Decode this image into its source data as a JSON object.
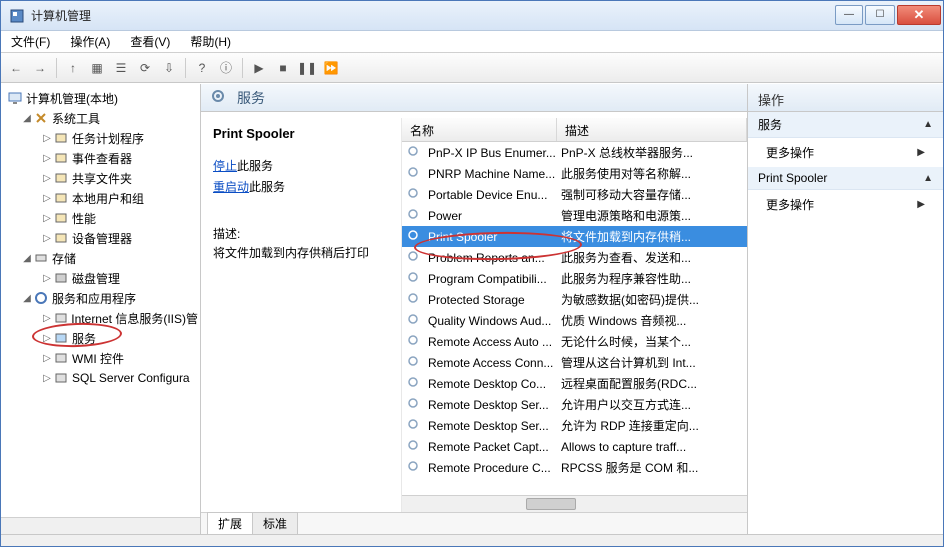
{
  "window": {
    "title": "计算机管理"
  },
  "menu": {
    "file": "文件(F)",
    "action": "操作(A)",
    "view": "查看(V)",
    "help": "帮助(H)"
  },
  "toolbar": {
    "back": "←",
    "fwd": "→",
    "up": "↑",
    "props": "▦",
    "list": "☰",
    "refresh": "⟳",
    "export": "⇩",
    "help": "?",
    "info": "ⓘ",
    "play": "▶",
    "stop": "■",
    "pause": "❚❚",
    "restart": "⏩"
  },
  "tree": {
    "root": "计算机管理(本地)",
    "systools": "系统工具",
    "systools_children": [
      "任务计划程序",
      "事件查看器",
      "共享文件夹",
      "本地用户和组",
      "性能",
      "设备管理器"
    ],
    "storage": "存储",
    "storage_children": [
      "磁盘管理"
    ],
    "svcapps": "服务和应用程序",
    "svcapps_children": [
      "Internet 信息服务(IIS)管",
      "服务",
      "WMI 控件",
      "SQL Server Configura"
    ]
  },
  "center": {
    "title": "服务",
    "selected_name": "Print Spooler",
    "stop_label": "停止",
    "stop_suffix": "此服务",
    "restart_label": "重启动",
    "restart_suffix": "此服务",
    "desc_label": "描述:",
    "desc_text": "将文件加载到内存供稍后打印"
  },
  "columns": {
    "name": "名称",
    "desc": "描述"
  },
  "services": [
    {
      "name": "PnP-X IP Bus Enumer...",
      "desc": "PnP-X 总线枚举器服务..."
    },
    {
      "name": "PNRP Machine Name...",
      "desc": "此服务使用对等名称解..."
    },
    {
      "name": "Portable Device Enu...",
      "desc": "强制可移动大容量存储..."
    },
    {
      "name": "Power",
      "desc": "管理电源策略和电源策..."
    },
    {
      "name": "Print Spooler",
      "desc": "将文件加载到内存供稍...",
      "selected": true
    },
    {
      "name": "Problem Reports an...",
      "desc": "此服务为查看、发送和..."
    },
    {
      "name": "Program Compatibili...",
      "desc": "此服务为程序兼容性助..."
    },
    {
      "name": "Protected Storage",
      "desc": "为敏感数据(如密码)提供..."
    },
    {
      "name": "Quality Windows Aud...",
      "desc": "优质 Windows 音频视..."
    },
    {
      "name": "Remote Access Auto ...",
      "desc": "无论什么时候，当某个..."
    },
    {
      "name": "Remote Access Conn...",
      "desc": "管理从这台计算机到 Int..."
    },
    {
      "name": "Remote Desktop Co...",
      "desc": "远程桌面配置服务(RDC..."
    },
    {
      "name": "Remote Desktop Ser...",
      "desc": "允许用户以交互方式连..."
    },
    {
      "name": "Remote Desktop Ser...",
      "desc": "允许为 RDP 连接重定向..."
    },
    {
      "name": "Remote Packet Capt...",
      "desc": "Allows to capture traff..."
    },
    {
      "name": "Remote Procedure C...",
      "desc": "RPCSS 服务是 COM 和..."
    }
  ],
  "tabs": {
    "ext": "扩展",
    "std": "标准"
  },
  "actions": {
    "title": "操作",
    "svc_head": "服务",
    "more": "更多操作",
    "sel_head": "Print Spooler"
  }
}
